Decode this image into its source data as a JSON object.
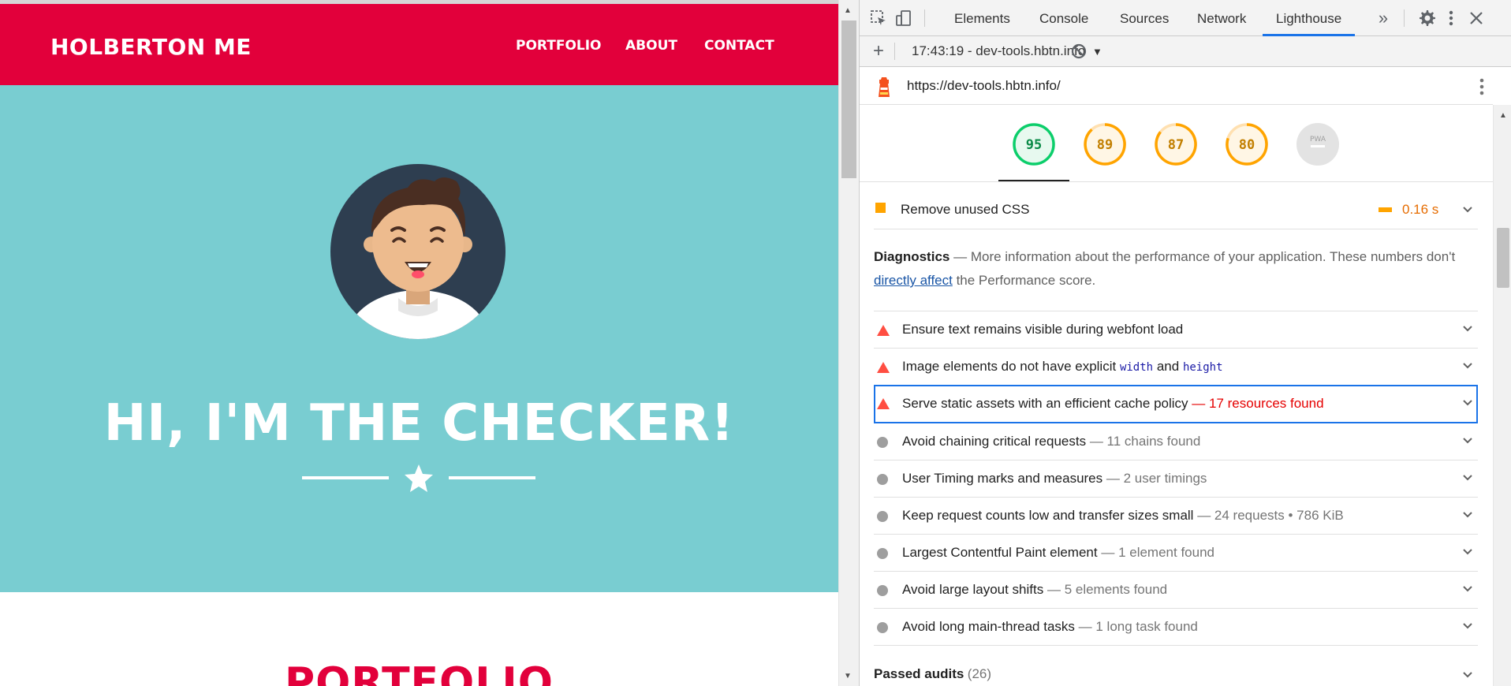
{
  "site": {
    "brand": "HOLBERTON ME",
    "nav": [
      "PORTFOLIO",
      "ABOUT",
      "CONTACT"
    ],
    "hero_title": "HI, I'M THE CHECKER!",
    "section_title": "PORTFOLIO",
    "colors": {
      "navbar": "#e2003b",
      "hero": "#79cdd1"
    }
  },
  "devtools": {
    "tabs": [
      "Elements",
      "Console",
      "Sources",
      "Network",
      "Lighthouse"
    ],
    "active_tab": "Lighthouse",
    "report_selector": "17:43:19 - dev-tools.hbtn.info",
    "url": "https://dev-tools.hbtn.info/",
    "scores": [
      {
        "value": "95",
        "color": "#0cce6b"
      },
      {
        "value": "89",
        "color": "#ffa400"
      },
      {
        "value": "87",
        "color": "#ffa400"
      },
      {
        "value": "80",
        "color": "#ffa400"
      },
      {
        "value": "PWA",
        "color": "#bdbdbd"
      }
    ],
    "opportunity": {
      "title": "Remove unused CSS",
      "value": "0.16 s"
    },
    "diagnostics": {
      "heading": "Diagnostics",
      "desc_before": "More information about the performance of your application. These numbers don't",
      "link": "directly affect",
      "desc_after": "the Performance score."
    },
    "audits": [
      {
        "title": "Ensure text remains visible during webfont load",
        "detail": "",
        "status": "fail"
      },
      {
        "title_parts": [
          "Image elements do not have explicit",
          "width",
          "and",
          "height"
        ],
        "status": "fail"
      },
      {
        "title": "Serve static assets with an efficient cache policy",
        "detail": "17 resources found",
        "status": "fail"
      },
      {
        "title": "Avoid chaining critical requests",
        "detail": "11 chains found",
        "status": "info"
      },
      {
        "title": "User Timing marks and measures",
        "detail": "2 user timings",
        "status": "info"
      },
      {
        "title": "Keep request counts low and transfer sizes small",
        "detail": "24 requests • 786 KiB",
        "status": "info"
      },
      {
        "title": "Largest Contentful Paint element",
        "detail": "1 element found",
        "status": "info"
      },
      {
        "title": "Avoid large layout shifts",
        "detail": "5 elements found",
        "status": "info"
      },
      {
        "title": "Avoid long main-thread tasks",
        "detail": "1 long task found",
        "status": "info"
      }
    ],
    "passed": {
      "label": "Passed audits",
      "count": "(26)"
    }
  }
}
